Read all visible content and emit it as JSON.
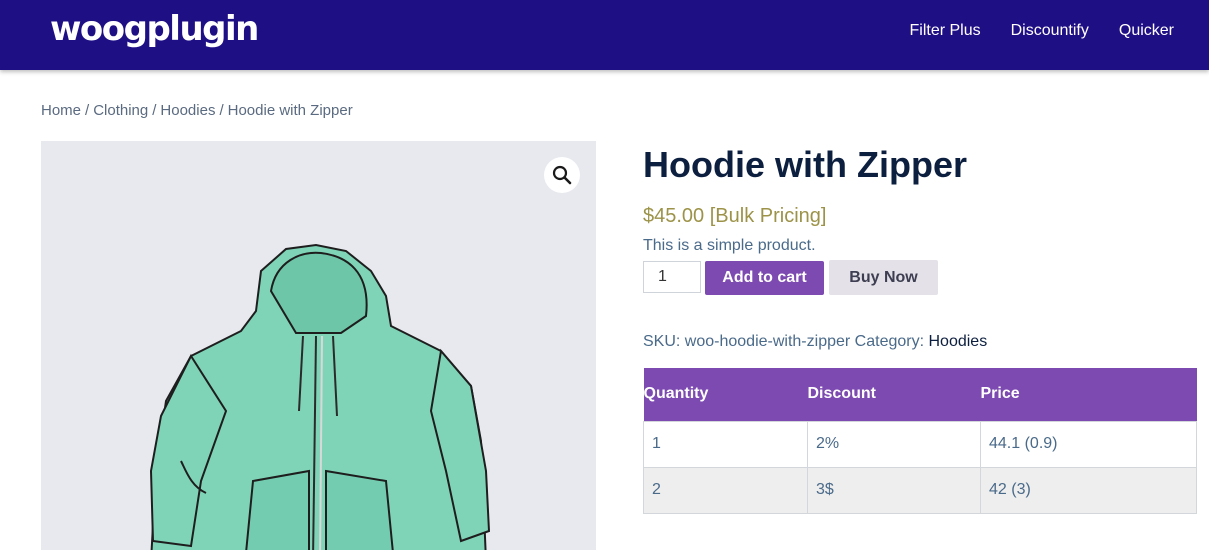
{
  "header": {
    "logo": "woogplugin",
    "nav": [
      "Filter Plus",
      "Discountify",
      "Quicker"
    ]
  },
  "breadcrumb": {
    "items": [
      "Home",
      "Clothing",
      "Hoodies"
    ],
    "current": "Hoodie with Zipper",
    "separator": "/"
  },
  "product": {
    "title": "Hoodie with Zipper",
    "price": "$45.00 [Bulk Pricing]",
    "short_description": "This is a simple product.",
    "quantity": "1",
    "add_to_cart_label": "Add to cart",
    "buy_now_label": "Buy Now",
    "sku_label": "SKU:",
    "sku": "woo-hoodie-with-zipper",
    "category_label": "Category:",
    "category": "Hoodies",
    "image_icon": "zoom-magnifier-icon"
  },
  "bulk_table": {
    "headers": [
      "Quantity",
      "Discount",
      "Price"
    ],
    "rows": [
      [
        "1",
        "2%",
        "44.1 (0.9)"
      ],
      [
        "2",
        "3$",
        "42 (3)"
      ]
    ]
  },
  "colors": {
    "header_bg": "#1f0f85",
    "accent": "#7c4ab0",
    "price": "#9c9348"
  }
}
